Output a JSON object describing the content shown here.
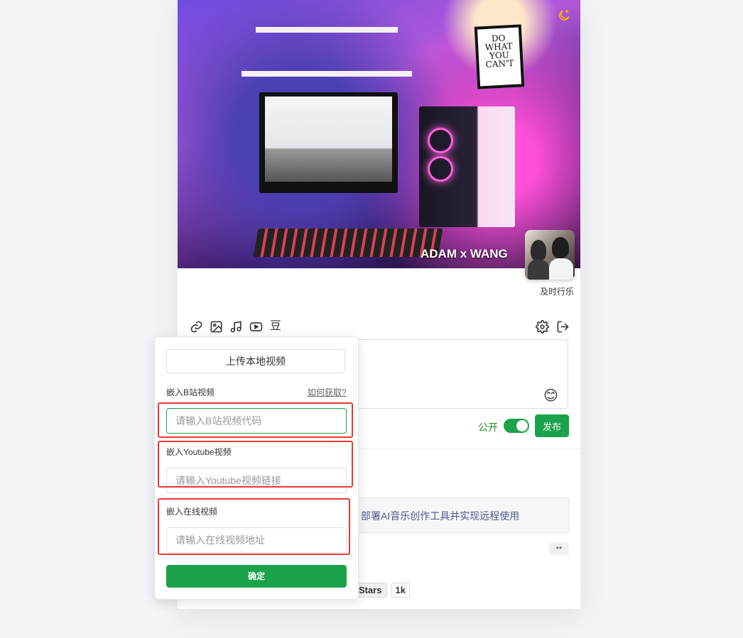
{
  "cover": {
    "title": "ADAM x WANG",
    "poster_text": "DO WHAT YOU CAN'T"
  },
  "profile": {
    "username": "及时行乐"
  },
  "toolbar": {
    "icons": [
      "link-icon",
      "image-icon",
      "music-icon",
      "youtube-icon",
      "douban-icon"
    ],
    "douban_label": "豆",
    "right_icons": [
      "settings-icon",
      "logout-icon"
    ]
  },
  "composer": {
    "visibility_label": "公开",
    "publish_label": "发布"
  },
  "post": {
    "text": "部署AI音乐创作工具并实现远程使用",
    "more": "••",
    "stars_label": "Stars",
    "stars_count": "1k"
  },
  "video_popup": {
    "upload_label": "上传本地视频",
    "bilibili_label": "嵌入B站视频",
    "howto_link": "如何获取?",
    "bilibili_placeholder": "请输入B站视频代码",
    "youtube_label": "嵌入Youtube视频",
    "youtube_placeholder": "请输入Youtube视频链接",
    "online_label": "嵌入在线视频",
    "online_placeholder": "请输入在线视频地址",
    "confirm_label": "确定"
  },
  "colors": {
    "accent": "#1aa34a",
    "highlight": "#e53935"
  }
}
